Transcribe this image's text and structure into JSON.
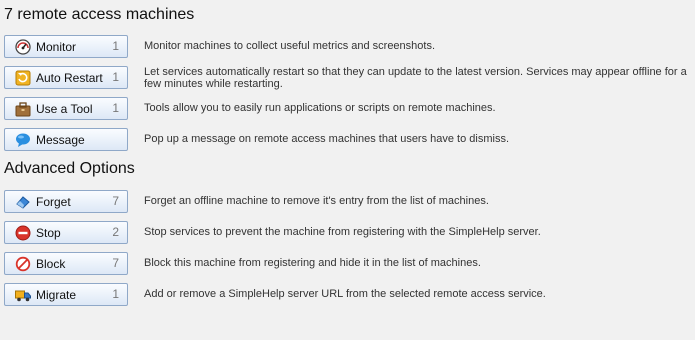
{
  "sections": {
    "remote_heading": "7 remote access machines",
    "advanced_heading": "Advanced Options"
  },
  "actions": [
    {
      "label": "Monitor",
      "count": "1",
      "icon": "gauge-icon",
      "description": "Monitor machines to collect useful metrics and screenshots."
    },
    {
      "label": "Auto Restart",
      "count": "1",
      "icon": "restart-icon",
      "description": "Let services automatically restart so that they can update to the latest version. Services may appear offline for a few minutes while restarting."
    },
    {
      "label": "Use a Tool",
      "count": "1",
      "icon": "toolbox-icon",
      "description": "Tools allow you to easily run applications or scripts on remote machines."
    },
    {
      "label": "Message",
      "count": "",
      "icon": "speech-bubble-icon",
      "description": "Pop up a message on remote access machines that users have to dismiss."
    }
  ],
  "advanced": [
    {
      "label": "Forget",
      "count": "7",
      "icon": "eraser-icon",
      "description": "Forget an offline machine to remove it's entry from the list of machines."
    },
    {
      "label": "Stop",
      "count": "2",
      "icon": "stop-icon",
      "description": "Stop services to prevent the machine from registering with the SimpleHelp server."
    },
    {
      "label": "Block",
      "count": "7",
      "icon": "block-icon",
      "description": "Block this machine from registering and hide it in the list of machines."
    },
    {
      "label": "Migrate",
      "count": "1",
      "icon": "truck-icon",
      "description": "Add or remove a SimpleHelp server URL from the selected remote access service."
    }
  ],
  "colors": {
    "button_border": "#8fa8c8",
    "button_bg": "#dde8f6",
    "background": "#f1f1f1"
  }
}
